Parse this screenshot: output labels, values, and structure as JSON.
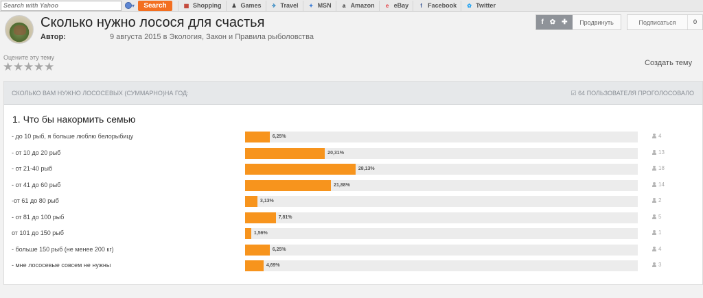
{
  "toolbar": {
    "search_placeholder": "Search with Yahoo",
    "search_button": "Search",
    "items": [
      {
        "label": "Shopping",
        "icon": "shopping-icon",
        "glyph": "▦",
        "color": "#c0392b"
      },
      {
        "label": "Games",
        "icon": "games-icon",
        "glyph": "♟",
        "color": "#444"
      },
      {
        "label": "Travel",
        "icon": "travel-icon",
        "glyph": "✈",
        "color": "#2e86c1"
      },
      {
        "label": "MSN",
        "icon": "msn-icon",
        "glyph": "✦",
        "color": "#3a7bd5"
      },
      {
        "label": "Amazon",
        "icon": "amazon-icon",
        "glyph": "a",
        "color": "#222"
      },
      {
        "label": "eBay",
        "icon": "ebay-icon",
        "glyph": "e",
        "color": "#e53238"
      },
      {
        "label": "Facebook",
        "icon": "facebook-icon",
        "glyph": "f",
        "color": "#3b5998"
      },
      {
        "label": "Twitter",
        "icon": "twitter-icon",
        "glyph": "✿",
        "color": "#1da1f2"
      }
    ]
  },
  "topic": {
    "title": "Сколько нужно лосося для счастья",
    "author_label": "Автор:",
    "date_and_category": "9 августа 2015 в Экология, Закон и Правила рыболовства"
  },
  "actions": {
    "promote_label": "Продвинуть",
    "subscribe_label": "Подписаться",
    "subscribe_count": "0",
    "rate_label": "Оцените эту тему",
    "create_topic": "Создать тему"
  },
  "poll": {
    "question": "СКОЛЬКО ВАМ НУЖНО ЛОСОСЕВЫХ (СУММАРНО)НА ГОД:",
    "voted_text": "☑ 64 ПОЛЬЗОВАТЕЛЯ ПРОГОЛОСОВАЛО",
    "subtitle": "1. Что бы накормить семью",
    "options": [
      {
        "label": "- до 10 рыб, я больше люблю белорыбицу",
        "percent": 6.25,
        "percent_text": "6,25%",
        "votes": "4"
      },
      {
        "label": "- от 10 до 20 рыб",
        "percent": 20.31,
        "percent_text": "20,31%",
        "votes": "13"
      },
      {
        "label": "- от 21-40 рыб",
        "percent": 28.13,
        "percent_text": "28,13%",
        "votes": "18"
      },
      {
        "label": "- от 41 до 60 рыб",
        "percent": 21.88,
        "percent_text": "21,88%",
        "votes": "14"
      },
      {
        "label": "-от 61 до 80 рыб",
        "percent": 3.13,
        "percent_text": "3,13%",
        "votes": "2"
      },
      {
        "label": "- от 81 до 100 рыб",
        "percent": 7.81,
        "percent_text": "7,81%",
        "votes": "5"
      },
      {
        "label": "от 101 до 150 рыб",
        "percent": 1.56,
        "percent_text": "1,56%",
        "votes": "1"
      },
      {
        "label": "- больше 150 рыб (не менее 200 кг)",
        "percent": 6.25,
        "percent_text": "6,25%",
        "votes": "4"
      },
      {
        "label": "- мне лососевые совсем не нужны",
        "percent": 4.69,
        "percent_text": "4,69%",
        "votes": "3"
      }
    ]
  }
}
